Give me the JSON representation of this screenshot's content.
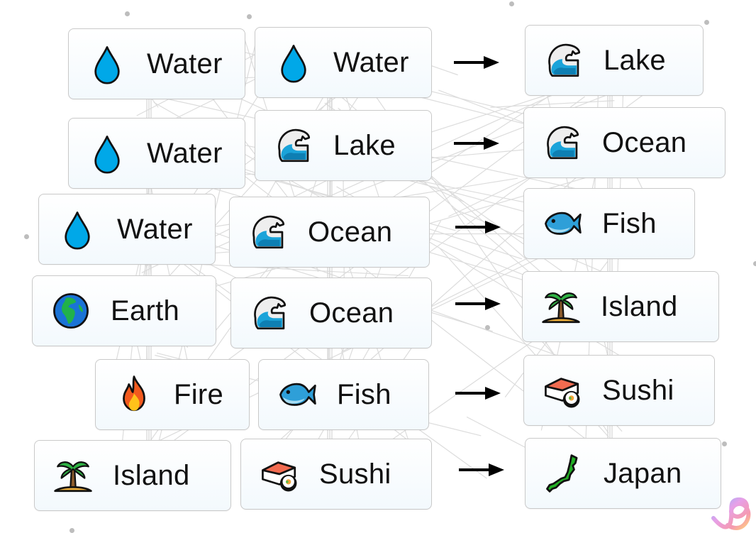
{
  "recipes": [
    {
      "first": {
        "label": "Water",
        "icon": "water-drop-icon"
      },
      "second": {
        "label": "Water",
        "icon": "water-drop-icon"
      },
      "result": {
        "label": "Lake",
        "icon": "wave-icon"
      }
    },
    {
      "first": {
        "label": "Water",
        "icon": "water-drop-icon"
      },
      "second": {
        "label": "Lake",
        "icon": "wave-icon"
      },
      "result": {
        "label": "Ocean",
        "icon": "wave-icon"
      }
    },
    {
      "first": {
        "label": "Water",
        "icon": "water-drop-icon"
      },
      "second": {
        "label": "Ocean",
        "icon": "wave-icon"
      },
      "result": {
        "label": "Fish",
        "icon": "fish-icon"
      }
    },
    {
      "first": {
        "label": "Earth",
        "icon": "globe-icon"
      },
      "second": {
        "label": "Ocean",
        "icon": "wave-icon"
      },
      "result": {
        "label": "Island",
        "icon": "island-icon"
      }
    },
    {
      "first": {
        "label": "Fire",
        "icon": "fire-icon"
      },
      "second": {
        "label": "Fish",
        "icon": "fish-icon"
      },
      "result": {
        "label": "Sushi",
        "icon": "sushi-icon"
      }
    },
    {
      "first": {
        "label": "Island",
        "icon": "island-icon"
      },
      "second": {
        "label": "Sushi",
        "icon": "sushi-icon"
      },
      "result": {
        "label": "Japan",
        "icon": "japan-map-icon"
      }
    }
  ],
  "arrow_icon": "right-arrow-icon",
  "logo_icon": "brand-logo-icon"
}
